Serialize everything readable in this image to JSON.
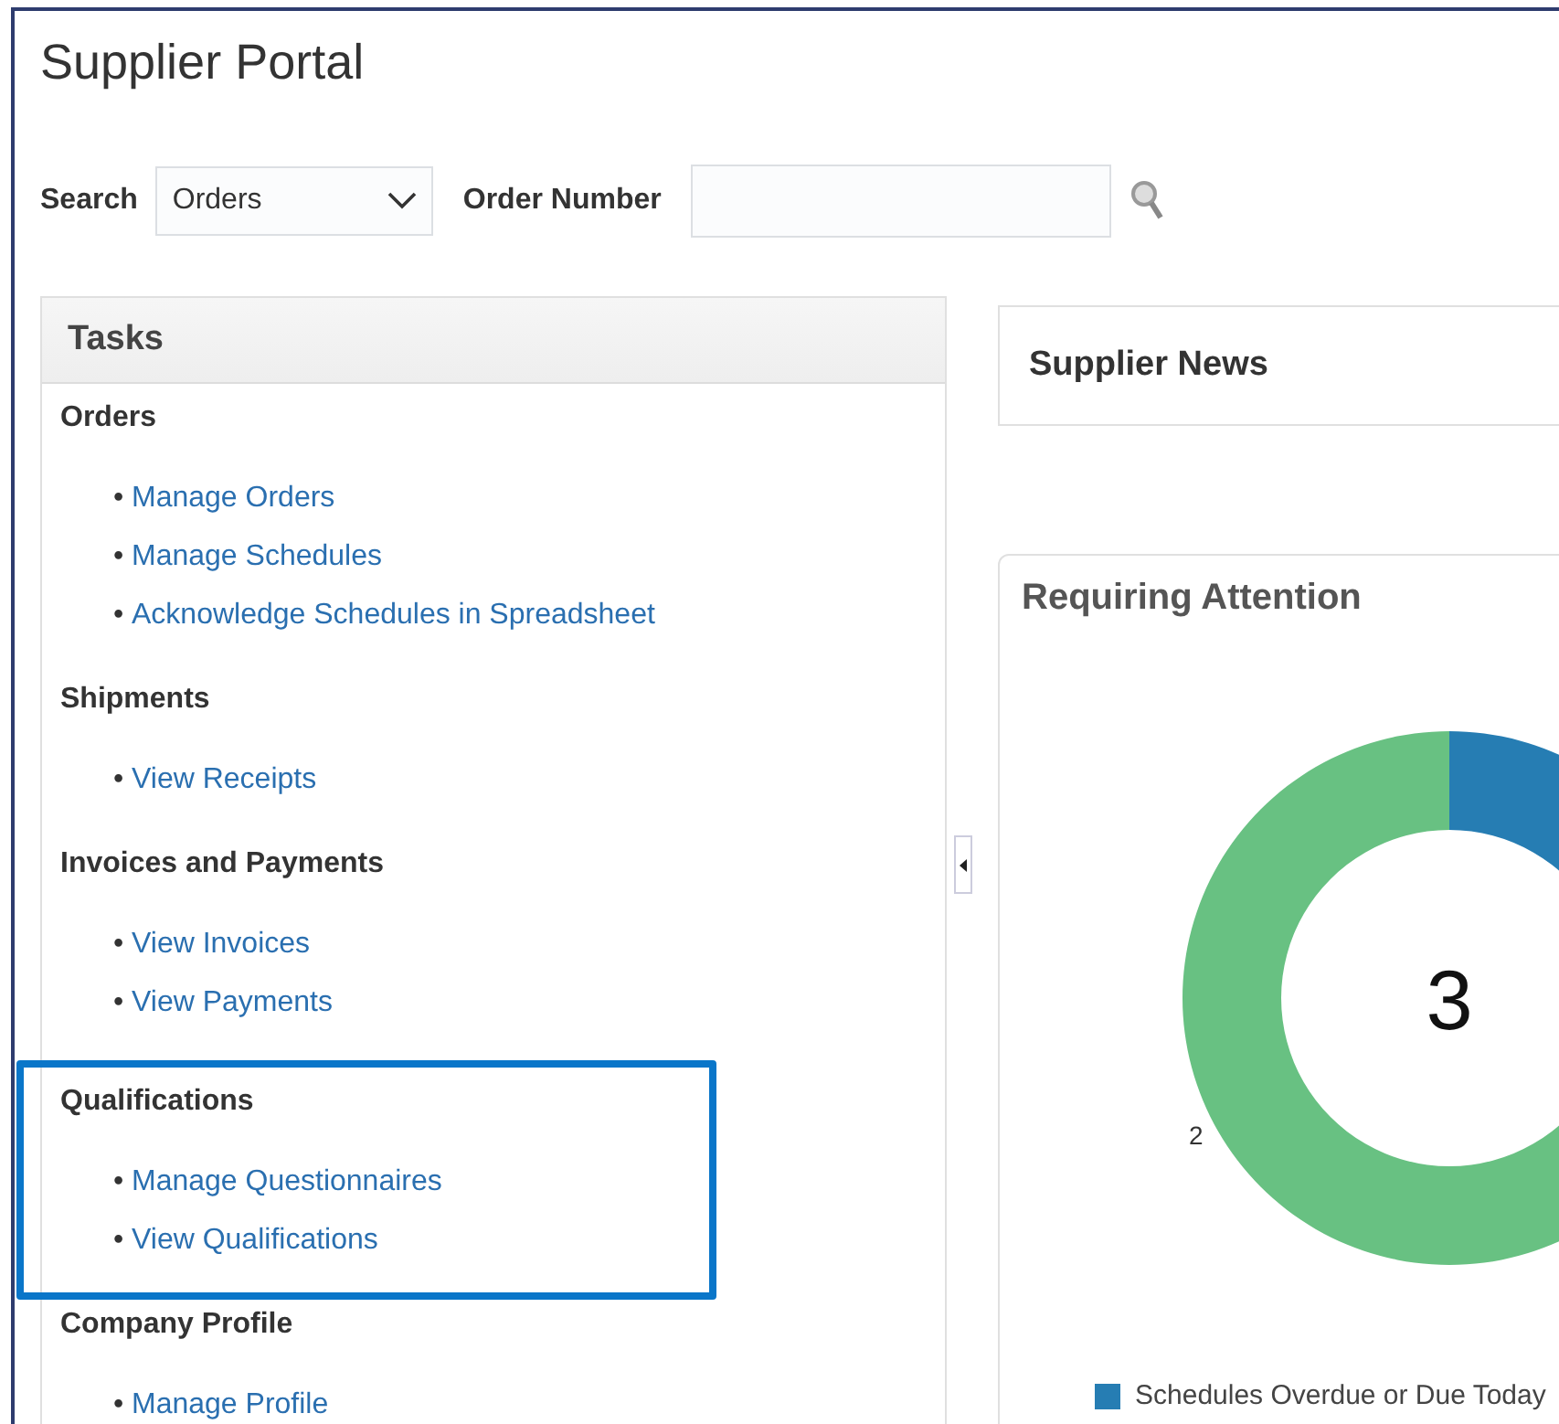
{
  "page": {
    "title": "Supplier Portal"
  },
  "search": {
    "label": "Search",
    "selected_value": "Orders",
    "field_label": "Order Number"
  },
  "tasks": {
    "title": "Tasks",
    "bullet": "•",
    "sections": [
      {
        "heading": "Orders",
        "highlighted": false,
        "links": [
          "Manage Orders",
          "Manage Schedules",
          "Acknowledge Schedules in Spreadsheet"
        ]
      },
      {
        "heading": "Shipments",
        "highlighted": false,
        "links": [
          "View Receipts"
        ]
      },
      {
        "heading": "Invoices and Payments",
        "highlighted": false,
        "links": [
          "View Invoices",
          "View Payments"
        ]
      },
      {
        "heading": "Qualifications",
        "highlighted": true,
        "links": [
          "Manage Questionnaires",
          "View Qualifications"
        ]
      },
      {
        "heading": "Company Profile",
        "highlighted": false,
        "links": [
          "Manage Profile"
        ]
      }
    ]
  },
  "news": {
    "title": "Supplier News"
  },
  "attention": {
    "title": "Requiring Attention",
    "center_label": "3",
    "chart_data": {
      "type": "donut",
      "categories": [
        "Schedules Overdue or Due Today",
        null
      ],
      "values": [
        1,
        2
      ],
      "colors": [
        "#267db3",
        "#68c182"
      ],
      "value_labels": [
        null,
        "2"
      ]
    }
  }
}
